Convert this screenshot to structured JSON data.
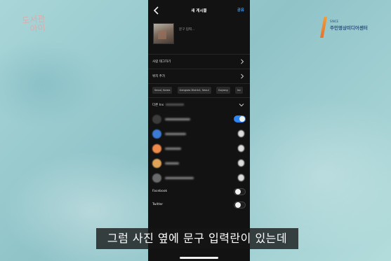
{
  "watermarks": {
    "left_logo_lines": [
      "도서관",
      "아이"
    ],
    "right_logo_small": "SINCE",
    "right_logo_name": "주민영상미디어센터"
  },
  "app": {
    "title": "새 게시물",
    "share_label": "공유",
    "caption_placeholder": "문구 입력...",
    "menu": [
      {
        "label": "사람 태그하기"
      },
      {
        "label": "위치 추가"
      }
    ],
    "location_chips": [
      "Seoul, Korea",
      "Gangseo District, Seoul",
      "Goyang",
      "Inc"
    ],
    "section_label": "다른 Ins",
    "accounts": [
      {
        "avatar_color": "#3b3b3b",
        "toggle": "on",
        "name_width": 0.72
      },
      {
        "avatar_color": "#3b7bd4",
        "toggle": "off",
        "name_width": 0.6
      },
      {
        "avatar_color": "#f08a4b",
        "toggle": "off",
        "name_width": 0.45
      },
      {
        "avatar_color": "#e0a35a",
        "toggle": "off",
        "name_width": 0.4
      },
      {
        "avatar_color": "#6a6a6a",
        "toggle": "off",
        "name_width": 0.82
      }
    ],
    "social": [
      {
        "label": "Facebook",
        "toggle": "off"
      },
      {
        "label": "Twitter",
        "toggle": "off"
      }
    ]
  },
  "subtitle": "그럼 사진 옆에 문구 입력란이 있는데",
  "colors": {
    "accent_blue": "#2f86f2",
    "link_blue": "#3897f0",
    "phone_bg": "#121212",
    "background_teal": "#9fcfd3"
  }
}
